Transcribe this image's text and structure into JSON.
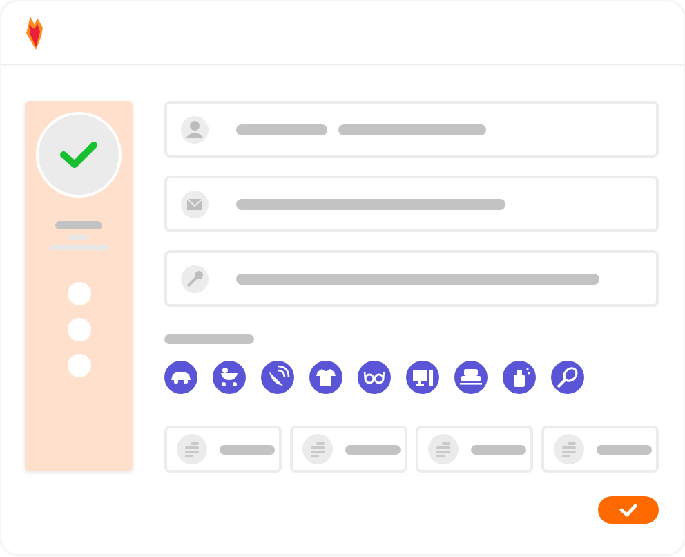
{
  "sidebar": {
    "completed": true,
    "steps": [
      {
        "kind": "dot"
      },
      {
        "kind": "dot"
      },
      {
        "kind": "dot"
      }
    ]
  },
  "fields": [
    {
      "kind": "person"
    },
    {
      "kind": "email"
    },
    {
      "kind": "key"
    }
  ],
  "categories": [
    {
      "kind": "car"
    },
    {
      "kind": "stroller"
    },
    {
      "kind": "dish"
    },
    {
      "kind": "shirt"
    },
    {
      "kind": "glasses"
    },
    {
      "kind": "computer"
    },
    {
      "kind": "sofa"
    },
    {
      "kind": "perfume"
    },
    {
      "kind": "racket"
    }
  ],
  "options": [
    {
      "kind": "coins"
    },
    {
      "kind": "coins"
    },
    {
      "kind": "coins"
    },
    {
      "kind": "coins"
    }
  ],
  "confirm": {
    "kind": "check"
  }
}
